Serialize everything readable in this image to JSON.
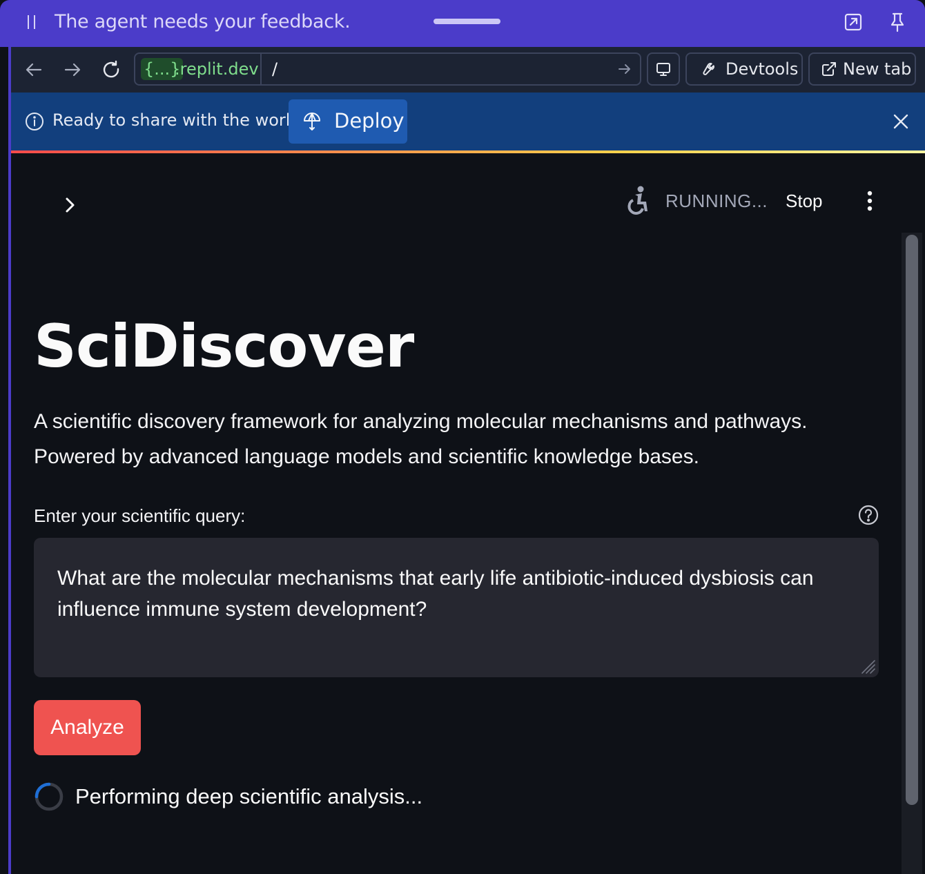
{
  "feedback_bar": {
    "text": "The agent needs your feedback.",
    "icons": [
      "pause-handle-icon",
      "popout-icon",
      "pin-icon"
    ]
  },
  "browser": {
    "url_host_badge": "{...}",
    "url_host_rest": ".replit.dev",
    "url_path": "/",
    "devtools_label": "Devtools",
    "new_tab_label": "New tab"
  },
  "banner": {
    "text": "Ready to share with the world?",
    "deploy_label": "Deploy"
  },
  "app": {
    "status": "RUNNING...",
    "stop_label": "Stop",
    "title": "SciDiscover",
    "description_line1": "A scientific discovery framework for analyzing molecular mechanisms and pathways.",
    "description_line2": "Powered by advanced language models and scientific knowledge bases.",
    "query_label": "Enter your scientific query:",
    "query_value": "What are the molecular mechanisms that early life antibiotic-induced dysbiosis can influence immune system development?",
    "analyze_label": "Analyze",
    "progress_text": "Performing deep scientific analysis..."
  },
  "colors": {
    "feedback_bar": "#4b3cc9",
    "url_bar": "#1c2333",
    "banner": "#123f7d",
    "deploy_button": "#1f5bb1",
    "app_background": "#0e1117",
    "input_background": "#262730",
    "primary_button": "#ef5350"
  }
}
